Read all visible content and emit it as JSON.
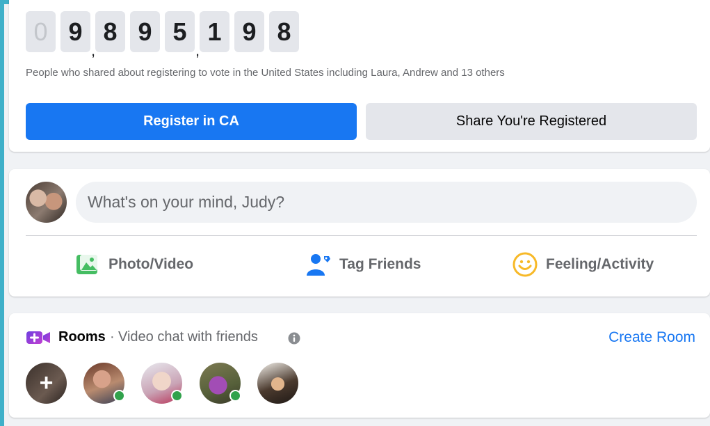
{
  "vote_counter": {
    "digits": [
      "0",
      "9",
      "8",
      "9",
      "5",
      "1",
      "9",
      "8"
    ],
    "description": "People who shared about registering to vote in the United States including Laura, Andrew and 13 others",
    "register_button": "Register in CA",
    "share_button": "Share You're Registered"
  },
  "composer": {
    "placeholder": "What's on your mind, Judy?",
    "actions": {
      "photo": "Photo/Video",
      "tag": "Tag Friends",
      "feeling": "Feeling/Activity"
    }
  },
  "rooms": {
    "title": "Rooms",
    "separator": "·",
    "subtitle": "Video chat with friends",
    "create_label": "Create Room",
    "create_plus": "+",
    "friends_online": [
      true,
      true,
      true,
      false
    ]
  },
  "colors": {
    "accent": "#1877f2",
    "frame": "#3fb0c9",
    "online": "#31a24c",
    "rooms_icon": "#8a3ffc"
  },
  "icons": {
    "photo": "photo-video-icon",
    "tag": "tag-friends-icon",
    "feeling": "feeling-smiley-icon",
    "rooms": "rooms-video-camera-icon",
    "info": "info-icon"
  }
}
